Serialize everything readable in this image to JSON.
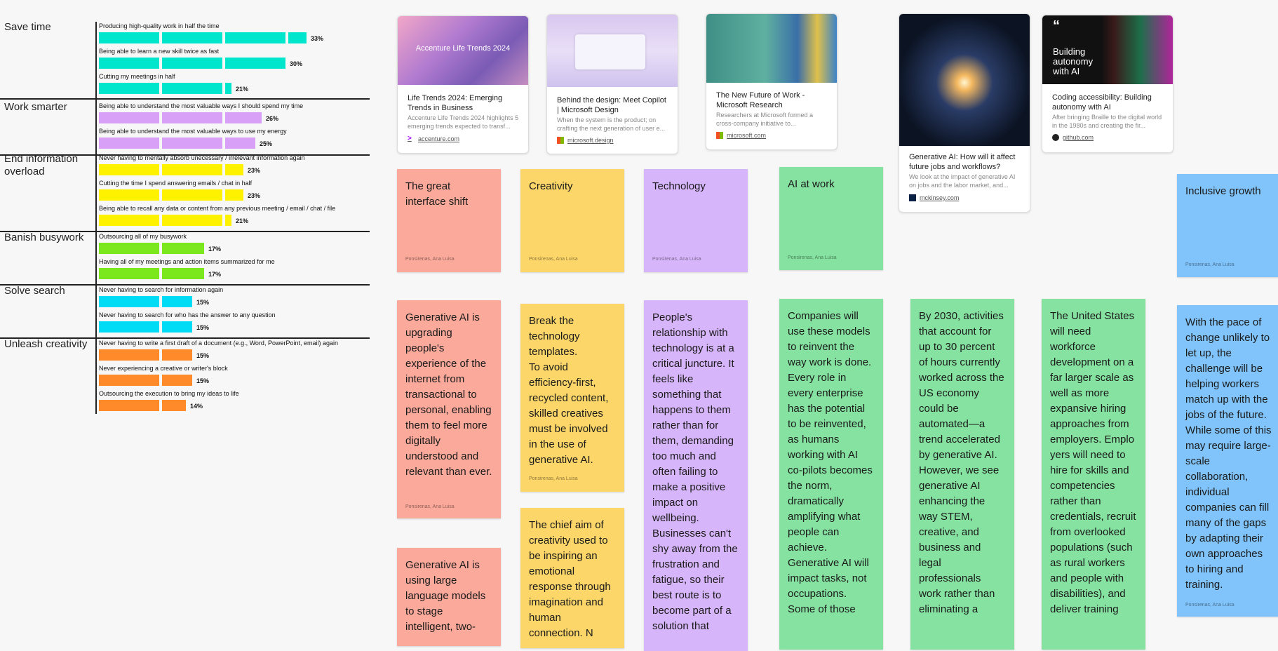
{
  "chart_data": {
    "type": "bar",
    "colors": {
      "save_time": "#00e6cc",
      "work_smarter": "#d8a0f6",
      "end_info": "#fff200",
      "busywork": "#7ae81c",
      "search": "#00dcf5",
      "creativity": "#ff8a2a"
    },
    "groups": [
      {
        "label": "Save time",
        "color": "#00e6cc",
        "bars": [
          {
            "label": "Producing high-quality work in half the time",
            "value": 33,
            "pct": "33%"
          },
          {
            "label": "Being able to learn a new skill twice as fast",
            "value": 30,
            "pct": "30%"
          },
          {
            "label": "Cutting my meetings in half",
            "value": 21,
            "pct": "21%"
          }
        ]
      },
      {
        "label": "Work smarter",
        "color": "#d8a0f6",
        "bars": [
          {
            "label": "Being able to understand the most valuable ways I should spend my time",
            "value": 26,
            "pct": "26%"
          },
          {
            "label": "Being able to understand the most valuable ways to use my energy",
            "value": 25,
            "pct": "25%"
          }
        ]
      },
      {
        "label": "End information overload",
        "color": "#fff200",
        "bars": [
          {
            "label": "Never having to mentally absorb unecessary / irrelevant information again",
            "value": 23,
            "pct": "23%"
          },
          {
            "label": "Cutting the time I spend answering emails / chat in half",
            "value": 23,
            "pct": "23%"
          },
          {
            "label": "Being able to recall any data or content from any previous meeting / email / chat / file",
            "value": 21,
            "pct": "21%"
          }
        ]
      },
      {
        "label": "Banish busywork",
        "color": "#7ae81c",
        "bars": [
          {
            "label": "Outsourcing all of my busywork",
            "value": 17,
            "pct": "17%"
          },
          {
            "label": "Having all of my meetings and action items summarized for me",
            "value": 17,
            "pct": "17%"
          }
        ]
      },
      {
        "label": "Solve search",
        "color": "#00dcf5",
        "bars": [
          {
            "label": "Never having to search for information again",
            "value": 15,
            "pct": "15%"
          },
          {
            "label": "Never having to search for who has the answer to any question",
            "value": 15,
            "pct": "15%"
          }
        ]
      },
      {
        "label": "Unleash creativity",
        "color": "#ff8a2a",
        "bars": [
          {
            "label": "Never having to write a first draft of a document (e.g., Word, PowerPoint, email) again",
            "value": 15,
            "pct": "15%"
          },
          {
            "label": "Never experiencing a creative or writer's block",
            "value": 15,
            "pct": "15%"
          },
          {
            "label": "Outsourcing the execution to bring my ideas to life",
            "value": 14,
            "pct": "14%"
          }
        ]
      }
    ]
  },
  "cards": [
    {
      "title": "Life Trends 2024: Emerging Trends in Business",
      "desc": "Accenture Life Trends 2024 highlights 5 emerging trends expected to transf...",
      "site": "accenture.com",
      "thumb_text": "Accenture Life Trends 2024",
      "icon": "accenture-icon"
    },
    {
      "title": "Behind the design: Meet Copilot | Microsoft Design",
      "desc": "When the system is the product; on crafting the next generation of user e...",
      "site": "microsoft.design",
      "icon": "microsoft-icon"
    },
    {
      "title": "The New Future of Work - Microsoft Research",
      "desc": "Researchers at Microsoft formed a cross-company initiative to...",
      "site": "microsoft.com",
      "icon": "microsoft-icon"
    },
    {
      "title": "Generative AI: How will it affect future jobs and workflows?",
      "desc": "We look at the impact of generative AI on jobs and the labor market, and...",
      "site": "mckinsey.com",
      "icon": "mckinsey-icon"
    },
    {
      "title": "Coding accessibility: Building autonomy with AI",
      "desc": "After bringing Braille to the digital world in the 1980s and creating the fir...",
      "site": "github.com",
      "thumb_text": "Building autonomy with AI",
      "icon": "github-icon"
    }
  ],
  "stickies": [
    {
      "text": "The great interface shift",
      "author": "Ponsirenas, Ana Luisa"
    },
    {
      "text": "Creativity",
      "author": "Ponsirenas, Ana Luisa"
    },
    {
      "text": "Technology",
      "author": "Ponsirenas, Ana Luisa"
    },
    {
      "text": "AI at work",
      "author": "Ponsirenas, Ana Luisa"
    },
    {
      "text": "Inclusive growth",
      "author": "Ponsirenas, Ana Luisa"
    },
    {
      "text": "Generative AI is upgrading people's experience of the internet from transactional to personal, enabling them to feel more digitally understood and relevant than ever.",
      "author": "Ponsirenas, Ana Luisa"
    },
    {
      "text": "Break the technology templates.\nTo avoid efficiency-first, recycled content, skilled creatives must be involved in the use of generative AI.",
      "author": "Ponsirenas, Ana Luisa"
    },
    {
      "text": "People's relationship with technology is at a critical juncture. It feels like something that happens to them rather than for them, demanding too much and often failing to make a positive impact on wellbeing. Businesses can't shy away from the frustration and fatigue, so their best route is to become part of a solution that"
    },
    {
      "text": "Companies will use these models to reinvent the way work is done. Every role in every enterprise has the potential to be reinvented, as humans working with AI co-pilots becomes the norm, dramatically amplifying what people can achieve. Generative AI will impact tasks, not occupations. Some of those"
    },
    {
      "text": "By 2030, activities that account for up to 30 percent of hours currently worked across the US economy could be automated—a trend accelerated by generative AI. However, we see generative AI enhancing the way STEM, creative, and business and legal professionals work rather than eliminating a"
    },
    {
      "text": "The United States will need workforce development on a far larger scale as well as more expansive hiring approaches from employers. Emplo yers will need to hire for skills and competencies rather than credentials, recruit from overlooked populations (such as rural workers and people with disabilities), and deliver training"
    },
    {
      "text": "With the pace of change unlikely to let up, the challenge will be helping workers match up with the jobs of the future. While some of this may require large-scale collaboration, individual companies can fill many of the gaps by adapting their own approaches to hiring and training.",
      "author": "Ponsirenas, Ana Luisa"
    },
    {
      "text": "The chief aim of creativity used to be inspiring an emotional response through imagination and human connection. N"
    },
    {
      "text": "Generative AI is using large language models to stage intelligent, two-"
    }
  ]
}
